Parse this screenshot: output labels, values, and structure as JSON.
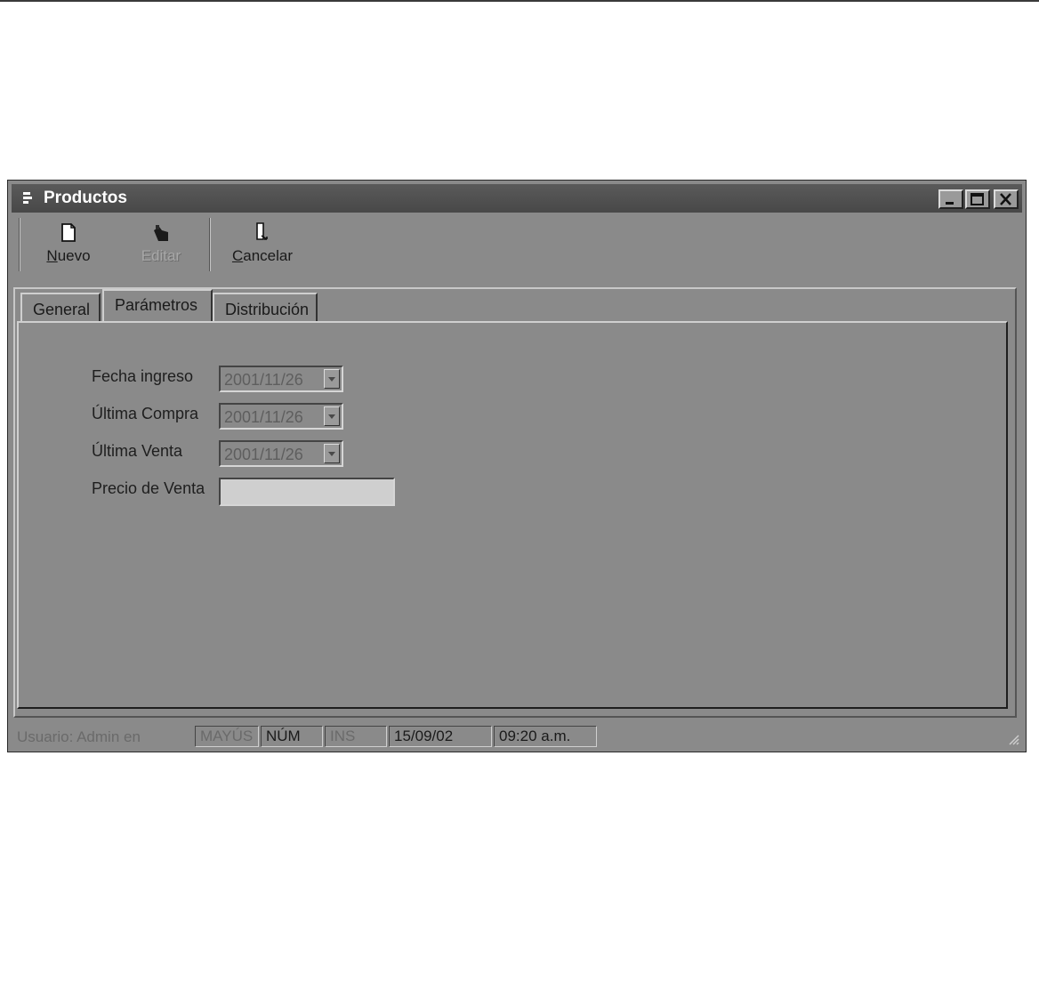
{
  "window": {
    "title": "Productos"
  },
  "toolbar": {
    "new_label": "Nuevo",
    "new_mnemonic": "N",
    "new_rest": "uevo",
    "edit_label": "Editar",
    "cancel_label": "Cancelar",
    "cancel_mnemonic": "C",
    "cancel_rest": "ancelar"
  },
  "tabs": [
    {
      "label": "General"
    },
    {
      "label": "Parámetros"
    },
    {
      "label": "Distribución"
    }
  ],
  "form": {
    "fecha_ingreso": {
      "label": "Fecha ingreso",
      "value": "2001/11/26"
    },
    "ultima_compra": {
      "label": "Última Compra",
      "value": "2001/11/26"
    },
    "ultima_venta": {
      "label": "Última Venta",
      "value": "2001/11/26"
    },
    "precio_venta": {
      "label": "Precio de Venta",
      "value": ""
    }
  },
  "status": {
    "user": "Usuario: Admin en",
    "caps": "MAYÚS",
    "num": "NÚM",
    "ins": "INS",
    "date": "15/09/02",
    "time": "09:20 a.m."
  }
}
